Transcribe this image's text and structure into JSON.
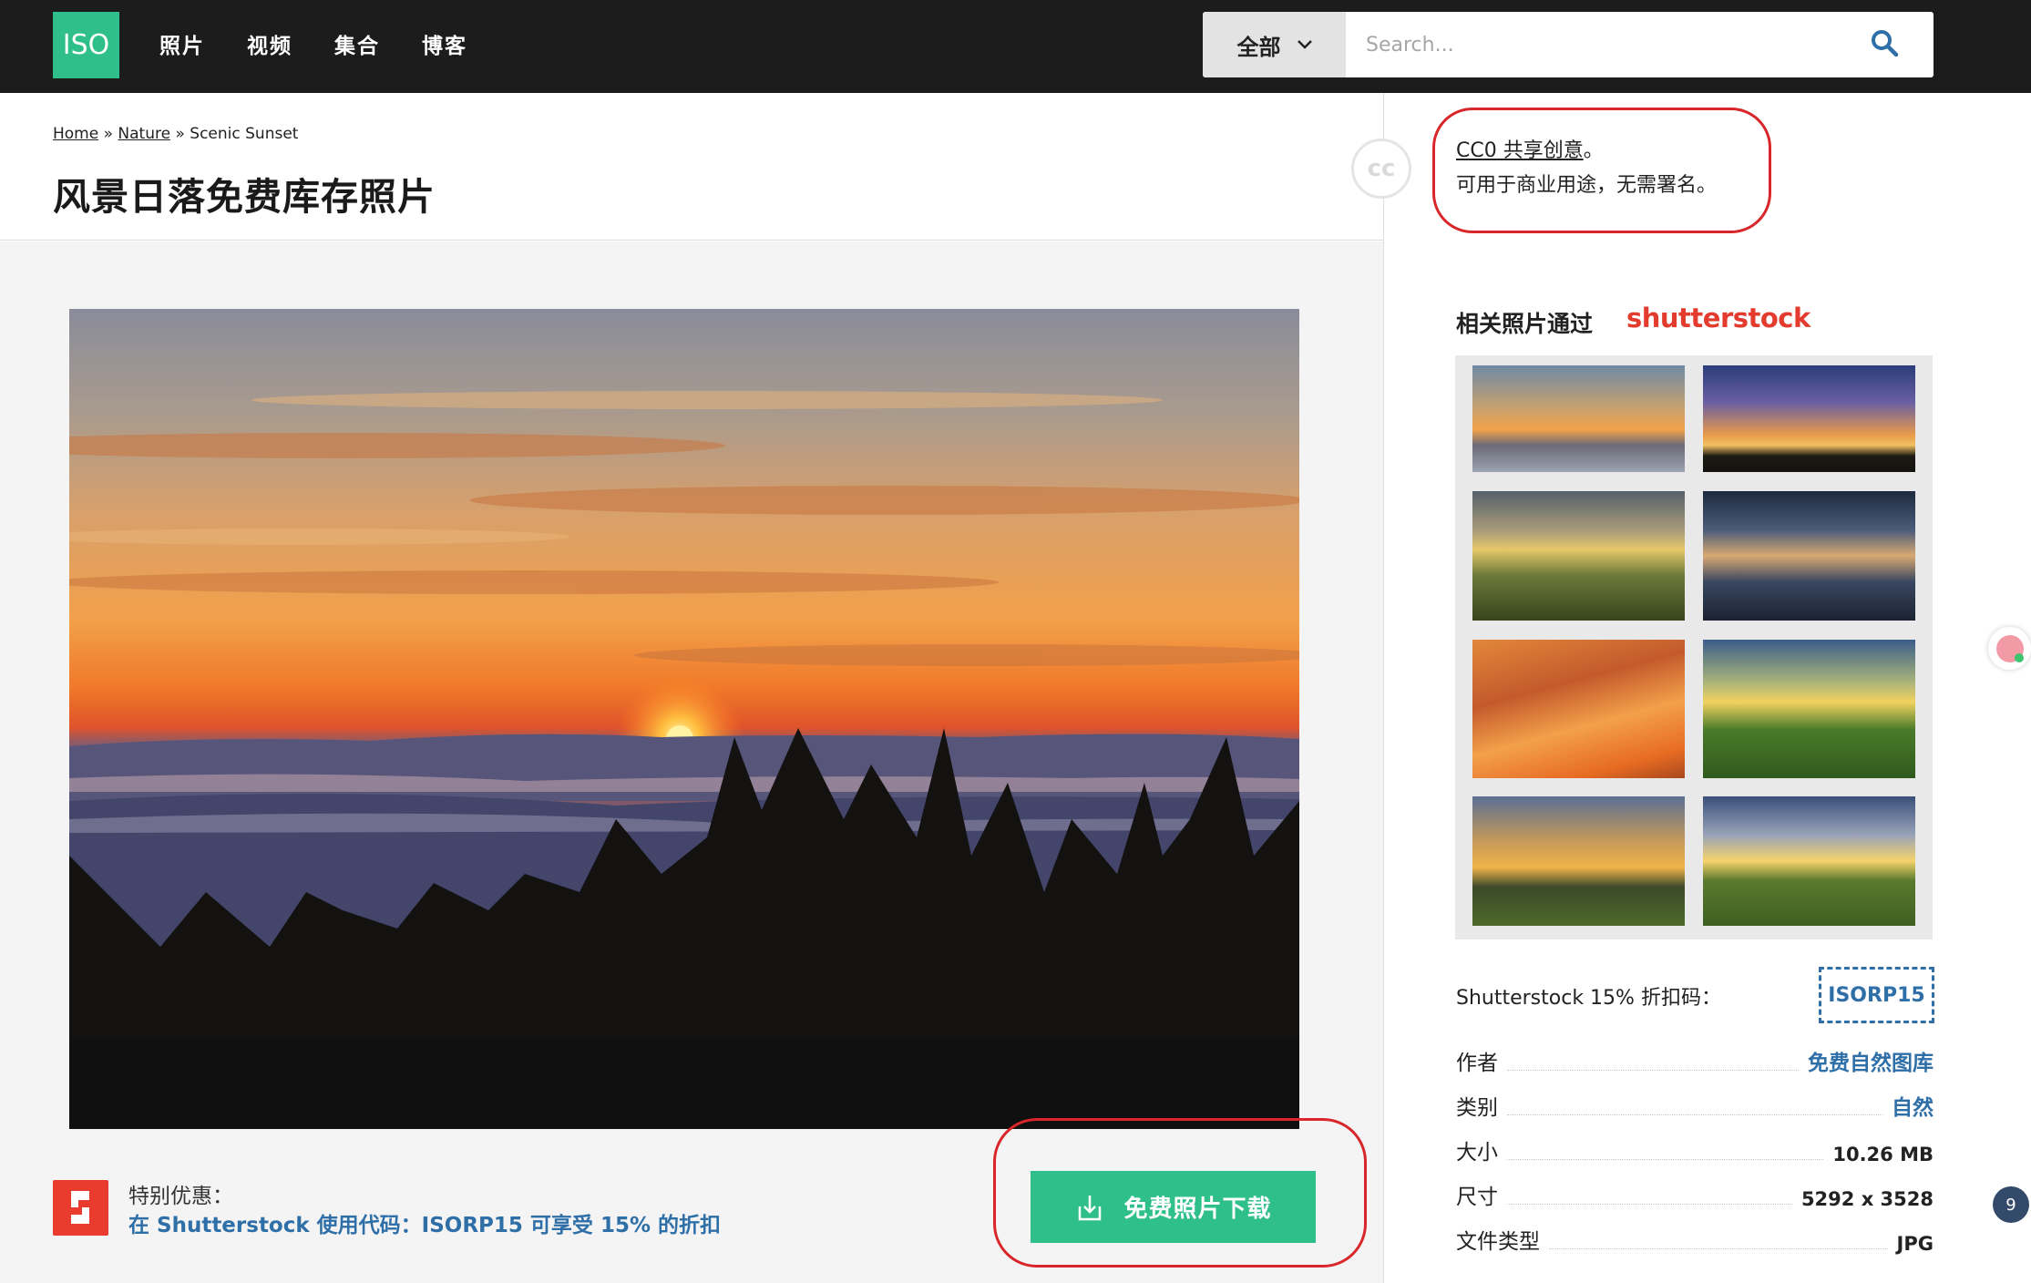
{
  "brand": {
    "logo_text": "ISO",
    "accent": "#2fbf8a"
  },
  "nav": {
    "items": [
      {
        "label": "照片"
      },
      {
        "label": "视频"
      },
      {
        "label": "集合"
      },
      {
        "label": "博客"
      }
    ]
  },
  "search": {
    "scope": "全部",
    "placeholder": "Search...",
    "icon": "search-icon"
  },
  "breadcrumb": {
    "home": "Home",
    "sep1": " » ",
    "nature": "Nature",
    "sep2": " » ",
    "current": "Scenic Sunset"
  },
  "page": {
    "title": "风景日落免费库存照片"
  },
  "cc_badge": "cc",
  "license": {
    "link_text": "CC0 共享创意",
    "suffix": "。",
    "note": "可用于商业用途，无需署名。"
  },
  "promo": {
    "title": "特别优惠：",
    "link": "在 Shutterstock 使用代码：ISORP15 可享受 15% 的折扣"
  },
  "download": {
    "label": "免费照片下载",
    "icon": "download-icon"
  },
  "related": {
    "title": "相关照片通过",
    "brand": "shutterstock"
  },
  "coupon": {
    "label": "Shutterstock 15% 折扣码：",
    "code": "ISORP15"
  },
  "meta": [
    {
      "key": "作者",
      "value": "免费自然图库",
      "link": true
    },
    {
      "key": "类别",
      "value": "自然",
      "link": true
    },
    {
      "key": "大小",
      "value": "10.26 MB",
      "link": false
    },
    {
      "key": "尺寸",
      "value": "5292 x 3528",
      "link": false
    },
    {
      "key": "文件类型",
      "value": "JPG",
      "link": false
    }
  ],
  "float_badge": "9",
  "colors": {
    "link": "#2f6fa8",
    "highlight": "#d8262a",
    "shutterstock": "#e33b2e",
    "topbar": "#1c1c1c"
  }
}
